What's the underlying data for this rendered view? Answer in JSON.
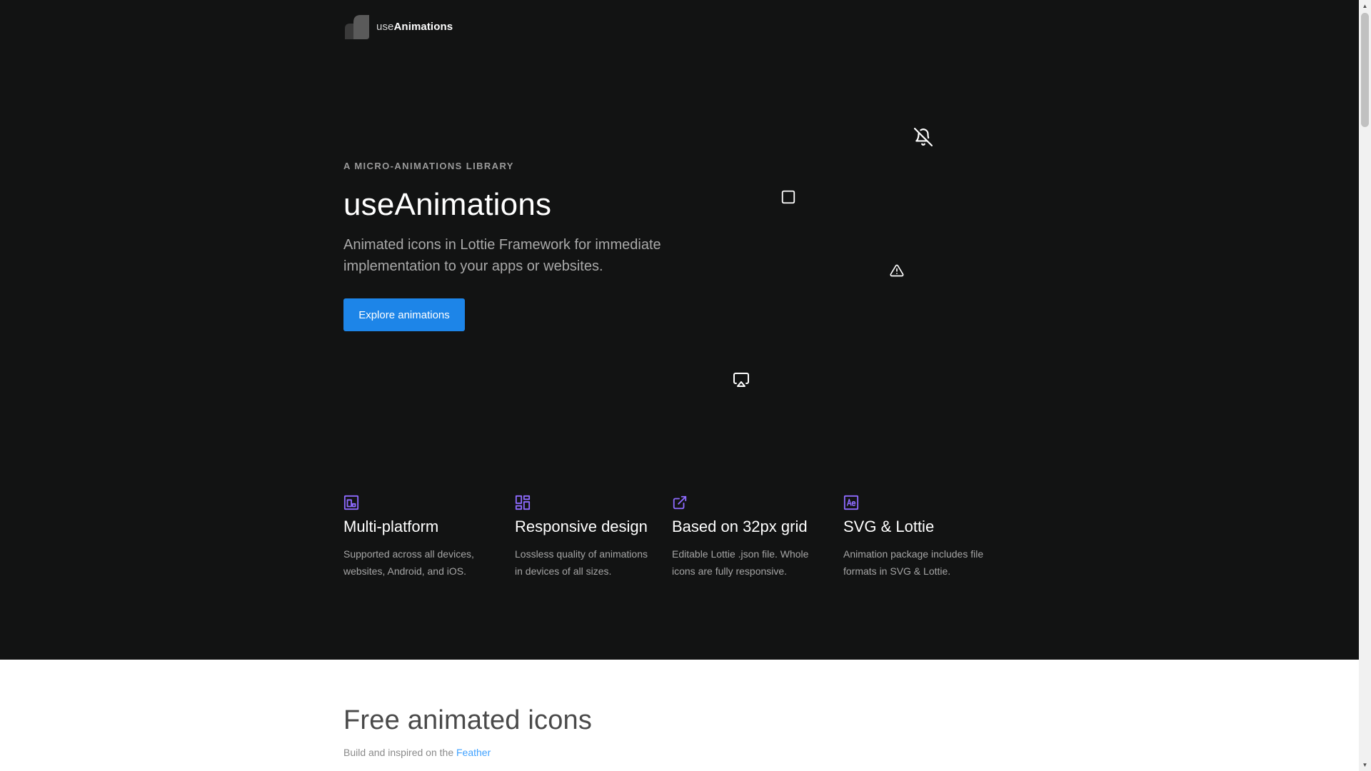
{
  "header": {
    "brand_prefix": "use",
    "brand_bold": "Animations",
    "logo_icon": "useanimations-logo-icon"
  },
  "hero": {
    "eyebrow": "A MICRO-ANIMATIONS LIBRARY",
    "title": "useAnimations",
    "subtitle": "Animated icons in Lottie Framework for immediate implementation to your apps or websites.",
    "cta_label": "Explore animations",
    "floating_icons": [
      "bell-off-icon",
      "square-icon",
      "alert-triangle-icon",
      "airplay-icon"
    ]
  },
  "features": [
    {
      "icon": "multi-platform-icon",
      "title": "Multi-platform",
      "desc": "Supported across all devices, websites, Android, and iOS."
    },
    {
      "icon": "layout-grid-icon",
      "title": "Responsive design",
      "desc": "Lossless quality of animations in devices of all sizes."
    },
    {
      "icon": "external-link-icon",
      "title": "Based on 32px grid",
      "desc": "Editable Lottie .json file. Whole icons are fully responsive."
    },
    {
      "icon": "after-effects-icon",
      "title": "SVG & Lottie",
      "desc": "Animation package includes file formats in SVG & Lottie."
    }
  ],
  "free_section": {
    "title": "Free animated icons",
    "subtitle_prefix": "Build and inspired on the ",
    "subtitle_link": "Feather"
  },
  "colors": {
    "hero_bg": "#121313",
    "accent": "#1d85e8",
    "feature_icon": "#8e6bff",
    "link": "#3fa1ff"
  }
}
